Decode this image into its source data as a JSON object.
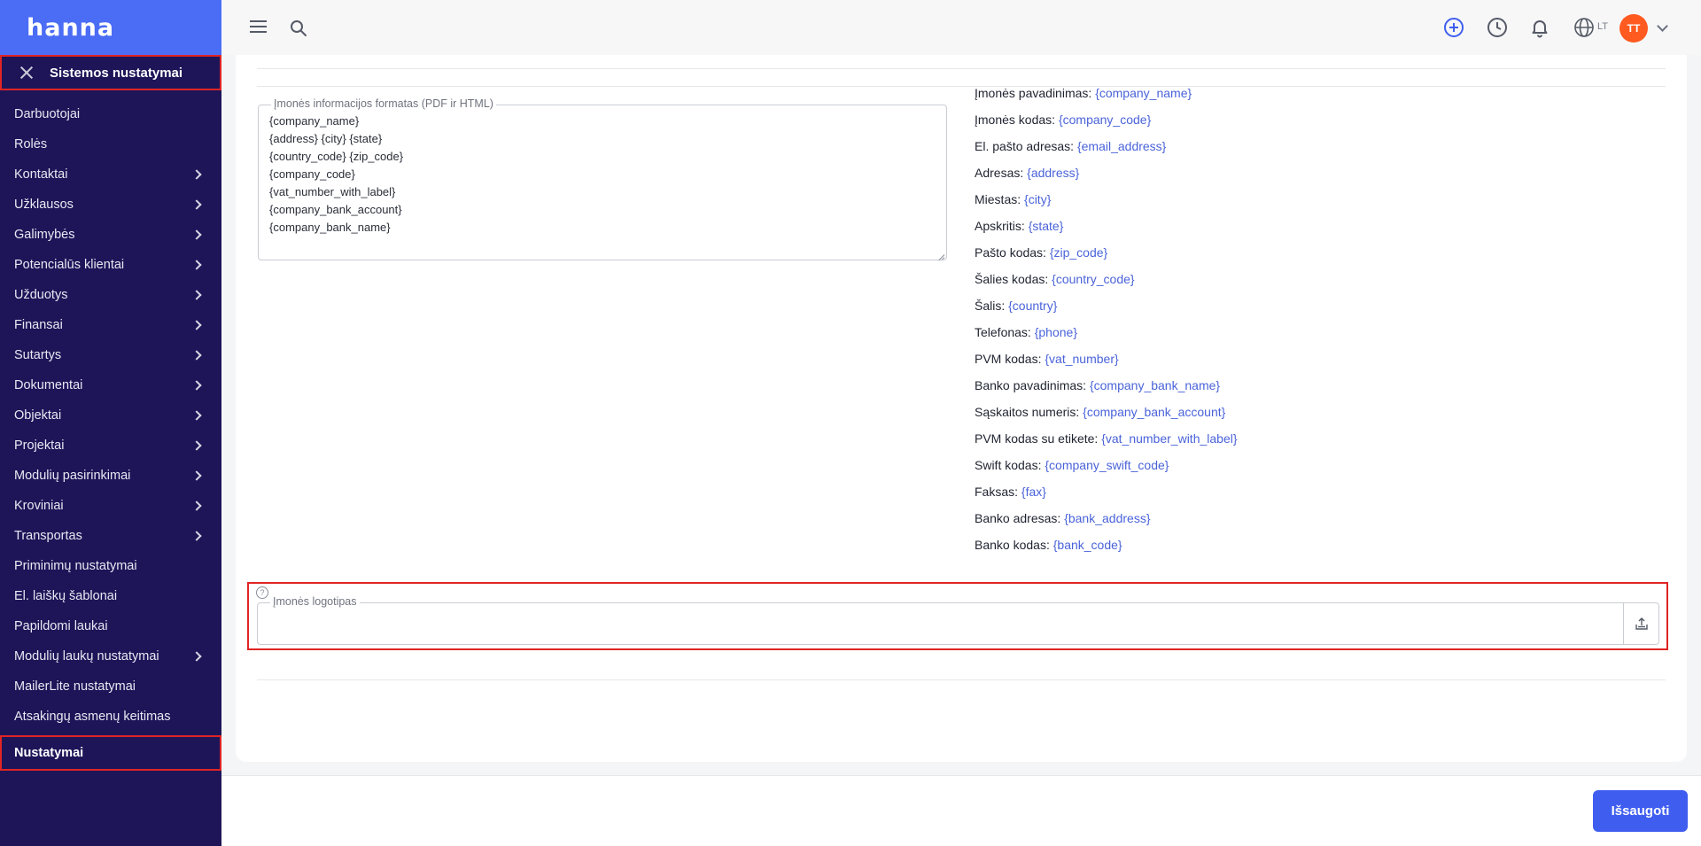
{
  "app": {
    "logo": "hanna"
  },
  "sidebar": {
    "section_title": "Sistemos nustatymai",
    "items": [
      {
        "label": "Darbuotojai",
        "has_submenu": false
      },
      {
        "label": "Rolės",
        "has_submenu": false
      },
      {
        "label": "Kontaktai",
        "has_submenu": true
      },
      {
        "label": "Užklausos",
        "has_submenu": true
      },
      {
        "label": "Galimybės",
        "has_submenu": true
      },
      {
        "label": "Potencialūs klientai",
        "has_submenu": true
      },
      {
        "label": "Užduotys",
        "has_submenu": true
      },
      {
        "label": "Finansai",
        "has_submenu": true
      },
      {
        "label": "Sutartys",
        "has_submenu": true
      },
      {
        "label": "Dokumentai",
        "has_submenu": true
      },
      {
        "label": "Objektai",
        "has_submenu": true
      },
      {
        "label": "Projektai",
        "has_submenu": true
      },
      {
        "label": "Modulių pasirinkimai",
        "has_submenu": true
      },
      {
        "label": "Kroviniai",
        "has_submenu": true
      },
      {
        "label": "Transportas",
        "has_submenu": true
      },
      {
        "label": "Priminimų nustatymai",
        "has_submenu": false
      },
      {
        "label": "El. laiškų šablonai",
        "has_submenu": false
      },
      {
        "label": "Papildomi laukai",
        "has_submenu": false
      },
      {
        "label": "Modulių laukų nustatymai",
        "has_submenu": true
      },
      {
        "label": "MailerLite nustatymai",
        "has_submenu": false
      },
      {
        "label": "Atsakingų asmenų keitimas",
        "has_submenu": false
      },
      {
        "label": "Nustatymai",
        "has_submenu": false,
        "active": true
      }
    ]
  },
  "topbar": {
    "language": "LT",
    "user_initials": "TT",
    "icons": [
      "menu-icon",
      "search-icon",
      "add-circle-icon",
      "clock-icon",
      "bell-icon",
      "globe-icon",
      "chevron-down-icon"
    ]
  },
  "company_format": {
    "legend": "Įmonės informacijos formatas (PDF ir HTML)",
    "value": "{company_name}\n{address} {city} {state}\n{country_code} {zip_code}\n{company_code}\n{vat_number_with_label}\n{company_bank_account}\n{company_bank_name}"
  },
  "placeholders": [
    {
      "label": "Įmonės pavadinimas:",
      "token": "{company_name}"
    },
    {
      "label": "Įmonės kodas:",
      "token": "{company_code}"
    },
    {
      "label": "El. pašto adresas:",
      "token": "{email_address}"
    },
    {
      "label": "Adresas:",
      "token": "{address}"
    },
    {
      "label": "Miestas:",
      "token": "{city}"
    },
    {
      "label": "Apskritis:",
      "token": "{state}"
    },
    {
      "label": "Pašto kodas:",
      "token": "{zip_code}"
    },
    {
      "label": "Šalies kodas:",
      "token": "{country_code}"
    },
    {
      "label": "Šalis:",
      "token": "{country}"
    },
    {
      "label": "Telefonas:",
      "token": "{phone}"
    },
    {
      "label": "PVM kodas:",
      "token": "{vat_number}"
    },
    {
      "label": "Banko pavadinimas:",
      "token": "{company_bank_name}"
    },
    {
      "label": "Sąskaitos numeris:",
      "token": "{company_bank_account}"
    },
    {
      "label": "PVM kodas su etikete:",
      "token": "{vat_number_with_label}"
    },
    {
      "label": "Swift kodas:",
      "token": "{company_swift_code}"
    },
    {
      "label": "Faksas:",
      "token": "{fax}"
    },
    {
      "label": "Banko adresas:",
      "token": "{bank_address}"
    },
    {
      "label": "Banko kodas:",
      "token": "{bank_code}"
    }
  ],
  "logo_field": {
    "legend": "Įmonės logotipas",
    "help": "?"
  },
  "footer": {
    "save_label": "Išsaugoti"
  },
  "colors": {
    "sidebar_bg": "#1d1558",
    "brand_blue": "#4b6cf5",
    "primary_button": "#3f5ef0",
    "placeholder_text": "#4a63d9",
    "avatar_bg": "#ff5a1f",
    "highlight_border": "#e02424"
  }
}
